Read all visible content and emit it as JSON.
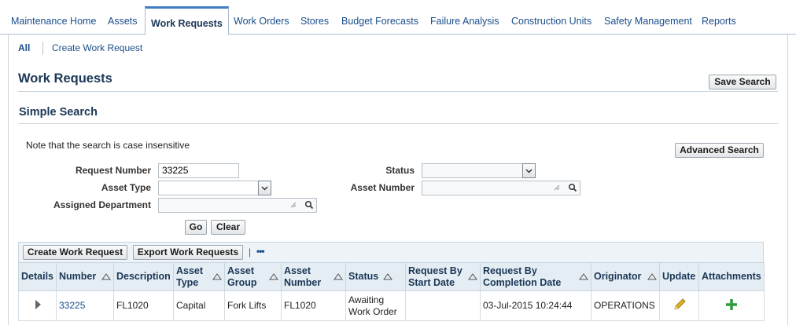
{
  "tabs": [
    {
      "label": "Maintenance Home",
      "active": false
    },
    {
      "label": "Assets",
      "active": false
    },
    {
      "label": "Work Requests",
      "active": true
    },
    {
      "label": "Work Orders",
      "active": false
    },
    {
      "label": "Stores",
      "active": false
    },
    {
      "label": "Budget Forecasts",
      "active": false
    },
    {
      "label": "Failure Analysis",
      "active": false
    },
    {
      "label": "Construction Units",
      "active": false
    },
    {
      "label": "Safety Management",
      "active": false
    },
    {
      "label": "Reports",
      "active": false
    }
  ],
  "subtabs": [
    {
      "label": "All",
      "selected": true
    },
    {
      "label": "Create Work Request",
      "selected": false
    }
  ],
  "page": {
    "title": "Work Requests",
    "save_search_label": "Save Search"
  },
  "search": {
    "section_title": "Simple Search",
    "note": "Note that the search is case insensitive",
    "advanced_label": "Advanced Search",
    "fields": {
      "request_number": {
        "label": "Request Number",
        "value": "33225"
      },
      "asset_type": {
        "label": "Asset Type",
        "value": ""
      },
      "assigned_department": {
        "label": "Assigned Department",
        "value": ""
      },
      "status": {
        "label": "Status",
        "value": ""
      },
      "asset_number": {
        "label": "Asset Number",
        "value": ""
      }
    },
    "go_label": "Go",
    "clear_label": "Clear"
  },
  "results": {
    "create_label": "Create Work Request",
    "export_label": "Export Work Requests",
    "separator": "|",
    "more_label": "•••",
    "columns": {
      "details": "Details",
      "number": "Number",
      "description": "Description",
      "asset_type_1": "Asset",
      "asset_type_2": "Type",
      "asset_group_1": "Asset",
      "asset_group_2": "Group",
      "asset_number_1": "Asset",
      "asset_number_2": "Number",
      "status": "Status",
      "start_1": "Request By",
      "start_2": "Start Date",
      "completion_1": "Request By",
      "completion_2": "Completion Date",
      "originator": "Originator",
      "update": "Update",
      "attachments": "Attachments"
    },
    "rows": [
      {
        "number": "33225",
        "description": "FL1020",
        "asset_type": "Capital",
        "asset_group": "Fork Lifts",
        "asset_number": "FL1020",
        "status_1": "Awaiting",
        "status_2": "Work Order",
        "start_date": "",
        "completion_date": "03-Jul-2015 10:24:44",
        "originator": "OPERATIONS"
      }
    ]
  },
  "colors": {
    "accent": "#3e7cc3",
    "link": "#1a4e8a",
    "header_bg": "#e5edf4",
    "add_icon": "#2e9b3e",
    "update_icon": "#e0b21d"
  },
  "icons": {
    "details": "triangle-right-icon",
    "update": "pencil-icon",
    "attachments": "plus-icon",
    "lov": "search-icon",
    "dropdown": "chevron-down-icon"
  }
}
